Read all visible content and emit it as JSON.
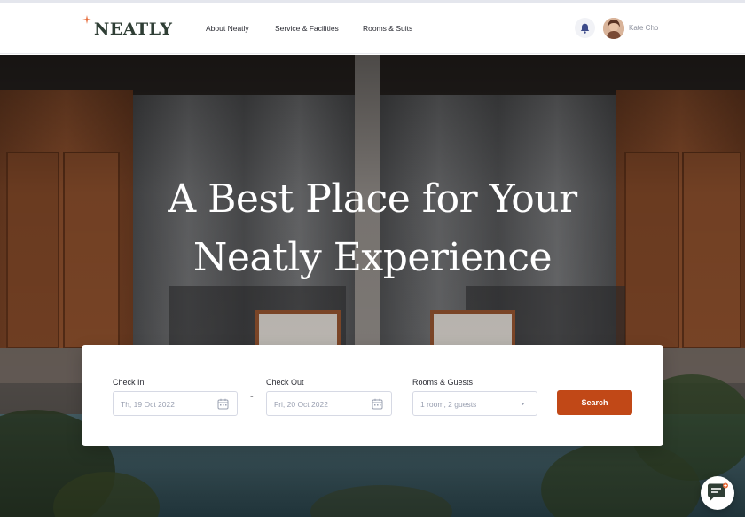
{
  "brand": {
    "name": "NEATLY",
    "accent_color": "#c14817",
    "logo_color": "#2f3e35"
  },
  "nav": {
    "items": [
      {
        "label": "About Neatly"
      },
      {
        "label": "Service & Facilities"
      },
      {
        "label": "Rooms & Suits"
      }
    ]
  },
  "user": {
    "name": "Kate Cho",
    "notification_icon": "bell-icon"
  },
  "hero": {
    "title_line1": "A Best Place for Your",
    "title_line2": "Neatly Experience"
  },
  "booking": {
    "check_in": {
      "label": "Check In",
      "value": "Th, 19 Oct 2022",
      "icon": "calendar-icon"
    },
    "separator": "-",
    "check_out": {
      "label": "Check Out",
      "value": "Fri, 20 Oct 2022",
      "icon": "calendar-icon"
    },
    "rooms_guests": {
      "label": "Rooms & Guests",
      "value": "1 room, 2 guests",
      "icon": "caret-down-icon"
    },
    "search_label": "Search"
  },
  "chat": {
    "icon": "chat-icon"
  }
}
